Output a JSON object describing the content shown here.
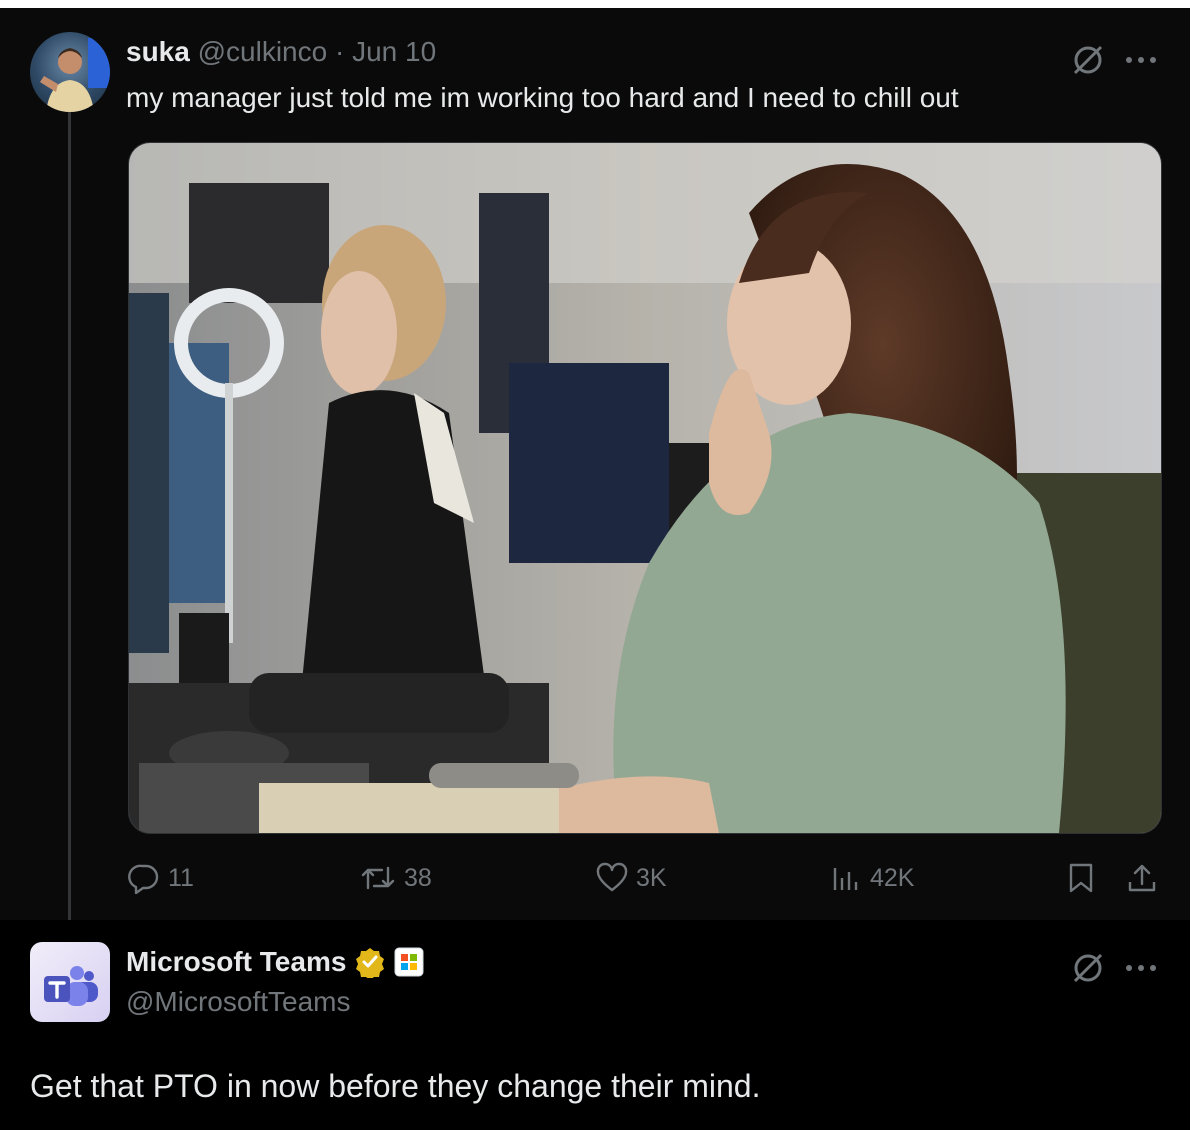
{
  "tweet": {
    "author_name": "suka",
    "author_handle": "@culkinco",
    "separator": "·",
    "date": "Jun 10",
    "text": "my manager just told me im working too hard and I need to chill out",
    "stats": {
      "replies": "11",
      "reposts": "38",
      "likes": "3K",
      "views": "42K"
    }
  },
  "reply": {
    "author_name": "Microsoft Teams",
    "author_handle": "@MicrosoftTeams",
    "text": "Get that PTO in now before they change their mind."
  },
  "colors": {
    "background": "#000000",
    "text_primary": "#e7e9ea",
    "text_secondary": "#71767b",
    "verified_gold": "#e2b719"
  }
}
